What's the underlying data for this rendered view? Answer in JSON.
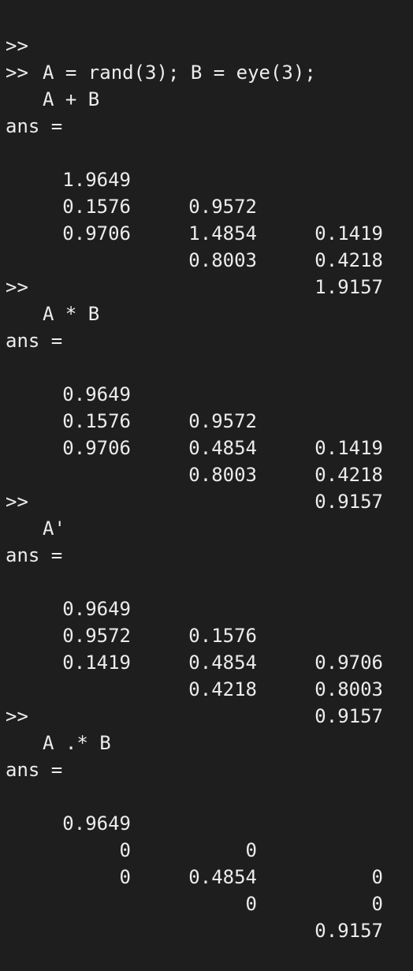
{
  "colors": {
    "background": "#1e1e1e",
    "text": "#ececec"
  },
  "blocks": [
    {
      "commands": [
        {
          "prompt": ">>",
          "text": "A = rand(3); B = eye(3);"
        },
        {
          "prompt": ">>",
          "text": "A + B"
        }
      ],
      "ans_label": "ans =",
      "matrix": [
        [
          "1.9649",
          "0.9572",
          "0.1419"
        ],
        [
          "0.1576",
          "1.4854",
          "0.4218"
        ],
        [
          "0.9706",
          "0.8003",
          "1.9157"
        ]
      ]
    },
    {
      "commands": [
        {
          "prompt": ">>",
          "text": "A * B"
        }
      ],
      "ans_label": "ans =",
      "matrix": [
        [
          "0.9649",
          "0.9572",
          "0.1419"
        ],
        [
          "0.1576",
          "0.4854",
          "0.4218"
        ],
        [
          "0.9706",
          "0.8003",
          "0.9157"
        ]
      ]
    },
    {
      "commands": [
        {
          "prompt": ">>",
          "text": "A'"
        }
      ],
      "ans_label": "ans =",
      "matrix": [
        [
          "0.9649",
          "0.1576",
          "0.9706"
        ],
        [
          "0.9572",
          "0.4854",
          "0.8003"
        ],
        [
          "0.1419",
          "0.4218",
          "0.9157"
        ]
      ]
    },
    {
      "commands": [
        {
          "prompt": ">>",
          "text": "A .* B"
        }
      ],
      "ans_label": "ans =",
      "matrix": [
        [
          "0.9649",
          "0",
          "0"
        ],
        [
          "0",
          "0.4854",
          "0"
        ],
        [
          "0",
          "0",
          "0.9157"
        ]
      ]
    }
  ]
}
